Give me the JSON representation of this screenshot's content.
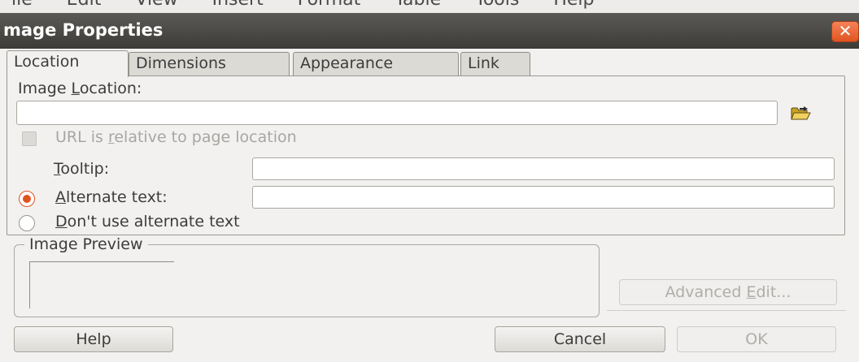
{
  "menubar": {
    "items": [
      "ile",
      "Edit",
      "View",
      "Insert",
      "Format",
      "Table",
      "Tools",
      "Help"
    ]
  },
  "dialog": {
    "title": "mage Properties",
    "close_glyph": "✕"
  },
  "tabs": [
    {
      "label": "Location",
      "active": true
    },
    {
      "label": "Dimensions",
      "active": false
    },
    {
      "label": "Appearance",
      "active": false
    },
    {
      "label": "Link",
      "active": false
    }
  ],
  "location": {
    "image_location_label_pre": "Image ",
    "image_location_label_u": "L",
    "image_location_label_post": "ocation:",
    "image_location_value": "",
    "relative_pre": "URL is ",
    "relative_u": "r",
    "relative_post": "elative to page location",
    "relative_checked": false,
    "tooltip_u": "T",
    "tooltip_post": "ooltip:",
    "tooltip_value": "",
    "alt_text_u": "A",
    "alt_text_post": "lternate text:",
    "alt_text_value": "",
    "no_alt_u": "D",
    "no_alt_post": "on't use alternate text"
  },
  "preview": {
    "legend": "Image Preview"
  },
  "buttons": {
    "advanced_edit_pre": "Advanced ",
    "advanced_edit_u": "E",
    "advanced_edit_post": "dit...",
    "help": "Help",
    "cancel": "Cancel",
    "ok": "OK"
  },
  "icons": {
    "folder": "folder-open-icon",
    "close": "close-icon"
  },
  "colors": {
    "accent": "#e05421",
    "titlebar": "#3c3b37",
    "window_bg": "#f2f1f0"
  }
}
